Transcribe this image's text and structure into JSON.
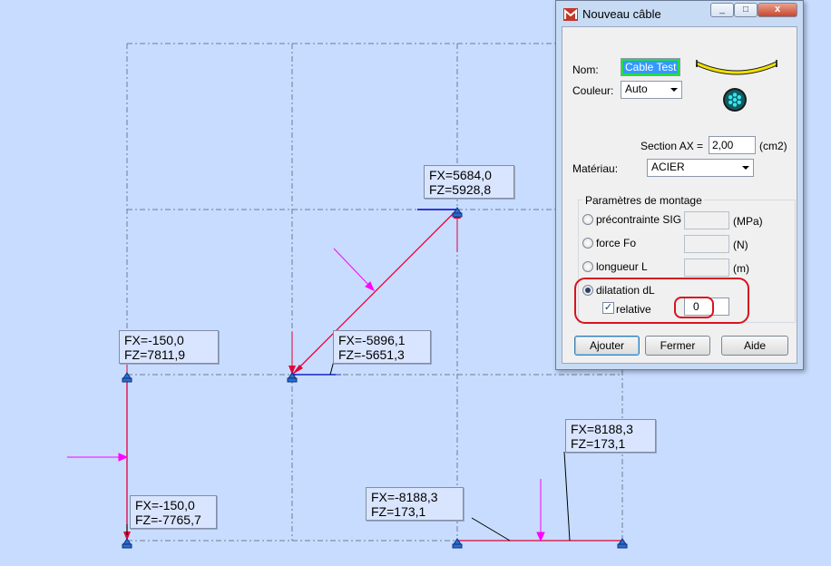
{
  "canvas": {
    "labels": [
      {
        "fx": "FX=5684,0",
        "fz": "FZ=5928,8"
      },
      {
        "fx": "FX=-150,0",
        "fz": "FZ=7811,9"
      },
      {
        "fx": "FX=-5896,1",
        "fz": "FZ=-5651,3"
      },
      {
        "fx": "FX=8188,3",
        "fz": "FZ=173,1"
      },
      {
        "fx": "FX=-150,0",
        "fz": "FZ=-7765,7"
      },
      {
        "fx": "FX=-8188,3",
        "fz": "FZ=173,1"
      }
    ]
  },
  "dialog": {
    "title": "Nouveau câble",
    "nom_label": "Nom:",
    "nom_value": "Cable Test",
    "couleur_label": "Couleur:",
    "couleur_value": "Auto",
    "section_label": "Section AX =",
    "section_value": "2,00",
    "section_unit": "(cm2)",
    "materiau_label": "Matériau:",
    "materiau_value": "ACIER",
    "group_title": "Paramètres de montage",
    "options": [
      {
        "label": "précontrainte SIG",
        "unit": "(MPa)",
        "selected": false
      },
      {
        "label": "force Fo",
        "unit": "(N)",
        "selected": false
      },
      {
        "label": "longueur L",
        "unit": "(m)",
        "selected": false
      },
      {
        "label": "dilatation dL",
        "unit": "",
        "selected": true
      }
    ],
    "relative_label": "relative",
    "relative_checked": true,
    "dilatation_value": "0",
    "buttons": {
      "add": "Ajouter",
      "close": "Fermer",
      "help": "Aide"
    },
    "close_glyph": "x",
    "min_glyph": "_",
    "max_glyph": "□",
    "check_glyph": "✓"
  },
  "colors": {
    "background": "#c8dcff",
    "member": "#e4003a",
    "load": "#ff00ff",
    "support": "#0000cc",
    "highlight": "#d8131d"
  }
}
